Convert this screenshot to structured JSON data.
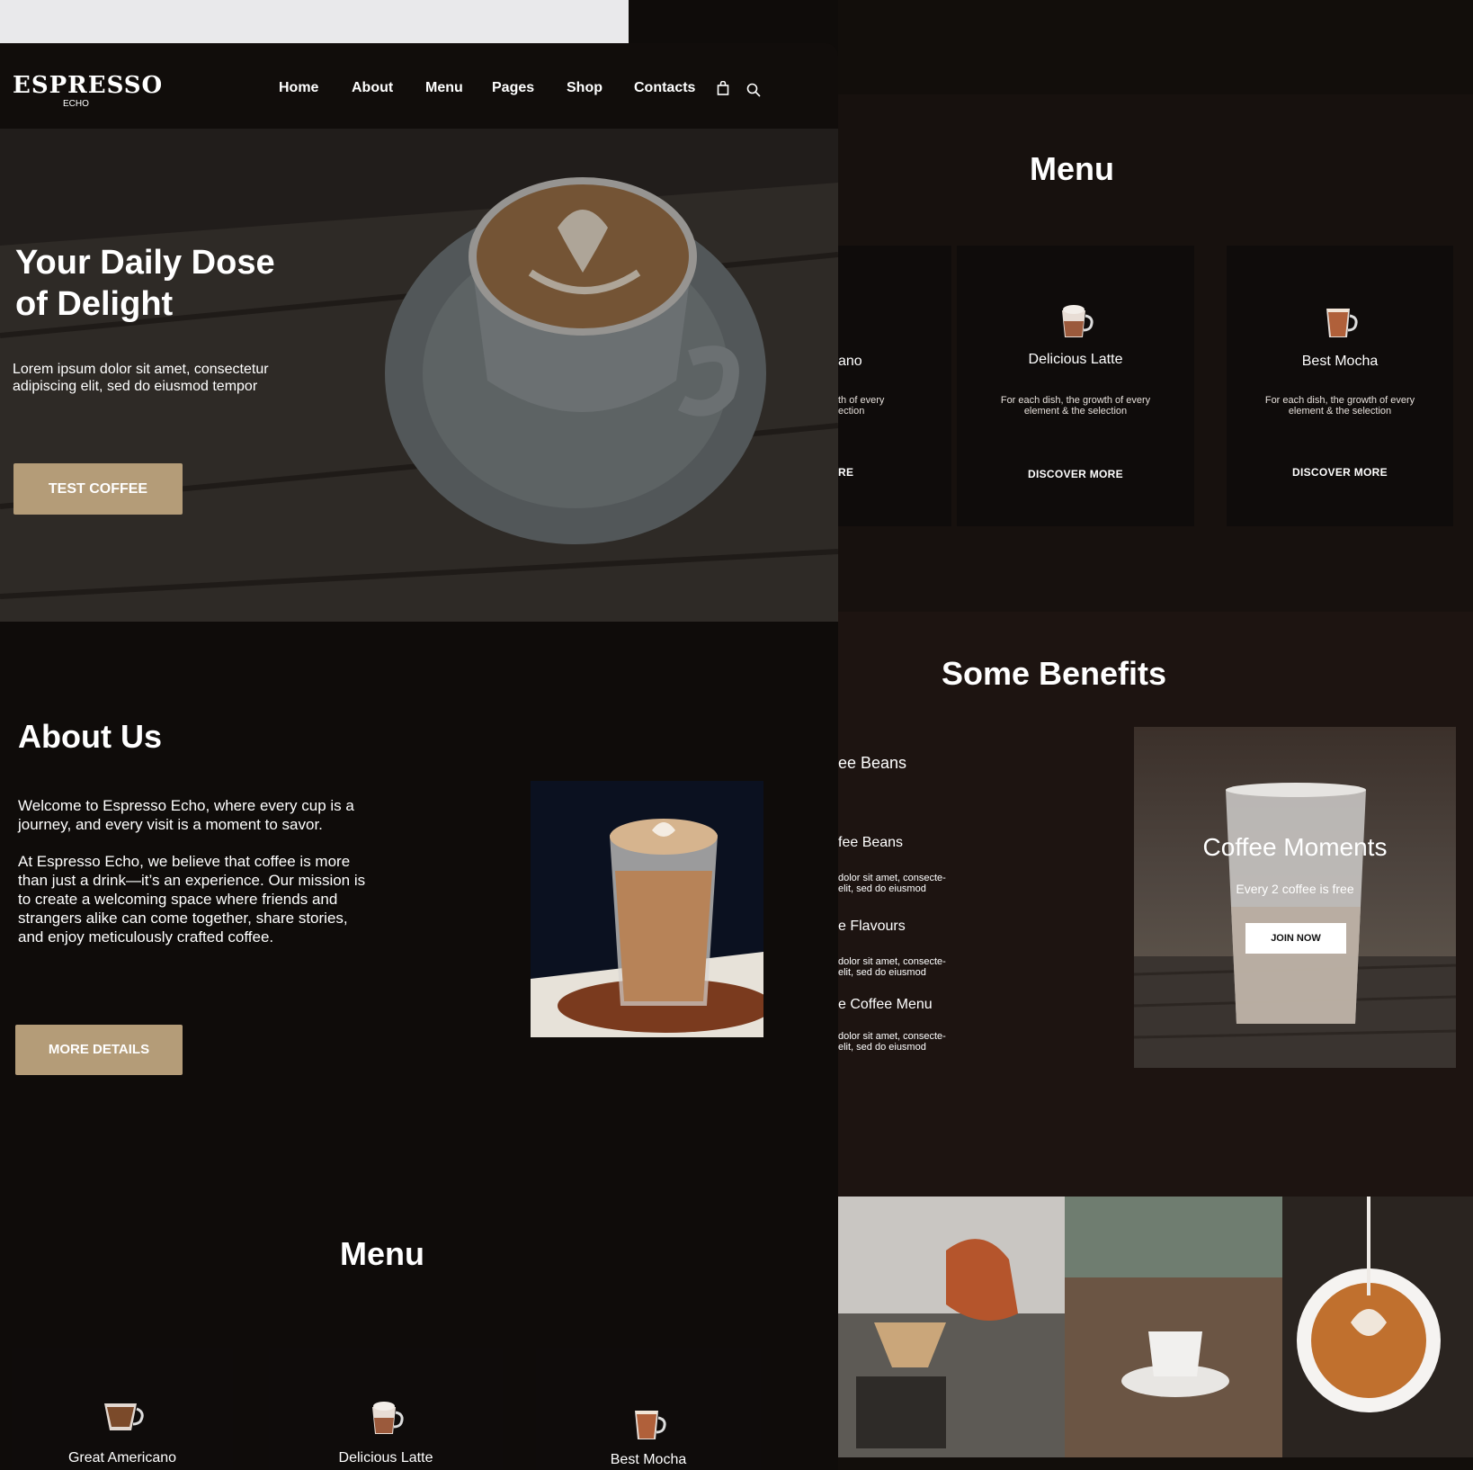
{
  "brand": {
    "logo_text": "ESPRESSO",
    "sub": "ECHO"
  },
  "nav": {
    "items": [
      "Home",
      "About",
      "Menu",
      "Pages",
      "Shop",
      "Contacts"
    ]
  },
  "hero": {
    "title_line1": "Your Daily Dose",
    "title_line2": "of Delight",
    "text_line1": "Lorem ipsum dolor sit amet, consectetur",
    "text_line2": "adipiscing elit, sed do eiusmod tempor",
    "button": "TEST COFFEE"
  },
  "about": {
    "title": "About Us",
    "p1_l1": "Welcome to Espresso Echo, where every cup is a",
    "p1_l2": "journey, and every visit is a moment to savor.",
    "p2_l1": "At Espresso Echo, we believe that coffee is more",
    "p2_l2": "than just a drink—it’s an experience. Our mission is",
    "p2_l3": "to create a welcoming space where friends and",
    "p2_l4": "strangers alike can come together, share stories,",
    "p2_l5": "and enjoy meticulously crafted coffee.",
    "button": "MORE DETAILS"
  },
  "menu_bottom": {
    "title": "Menu",
    "items": [
      "Great Americano",
      "Delicious Latte",
      "Best Mocha"
    ]
  },
  "menu_right": {
    "title": "Menu",
    "cards": [
      {
        "name": "ano",
        "d1": "th of every",
        "d2": "ection",
        "link": "RE"
      },
      {
        "name": "Delicious Latte",
        "d1": "For each dish, the growth of every",
        "d2": "element & the selection",
        "link": "DISCOVER MORE"
      },
      {
        "name": "Best Mocha",
        "d1": "For each dish, the growth of every",
        "d2": "element & the selection",
        "link": "DISCOVER MORE"
      }
    ]
  },
  "benefits": {
    "title": "Some Benefits",
    "items": [
      {
        "title": "ee Beans",
        "l1": "",
        "l2": ""
      },
      {
        "title": "fee Beans",
        "l1": "dolor sit amet, consecte-",
        "l2": "elit, sed do eiusmod"
      },
      {
        "title": "e Flavours",
        "l1": "dolor sit amet, consecte-",
        "l2": "elit, sed do eiusmod"
      },
      {
        "title": "e Coffee Menu",
        "l1": "dolor sit amet, consecte-",
        "l2": "elit, sed do eiusmod"
      }
    ],
    "promo": {
      "title": "Coffee Moments",
      "sub": "Every 2 coffee is free",
      "button": "JOIN NOW"
    }
  },
  "icons": [
    "bag-icon",
    "search-icon",
    "cup-icon"
  ],
  "colors": {
    "accent": "#b49c78",
    "bg": "#0f0c0a"
  }
}
